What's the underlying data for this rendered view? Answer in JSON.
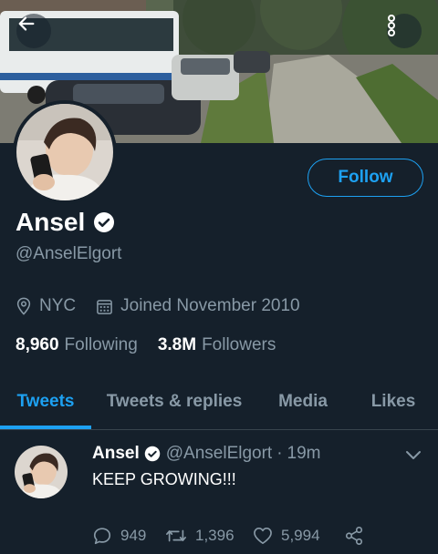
{
  "header": {
    "back_icon": "arrow-left-icon",
    "more_icon": "more-vertical-icon"
  },
  "profile": {
    "name": "Ansel",
    "handle": "@AnselElgort",
    "verified": true,
    "location": "NYC",
    "joined": "Joined November 2010",
    "following_count": "8,960",
    "following_label": "Following",
    "followers_count": "3.8M",
    "followers_label": "Followers",
    "follow_label": "Follow"
  },
  "tabs": [
    {
      "label": "Tweets",
      "active": true
    },
    {
      "label": "Tweets & replies",
      "active": false
    },
    {
      "label": "Media",
      "active": false
    },
    {
      "label": "Likes",
      "active": false
    }
  ],
  "tweet": {
    "name": "Ansel",
    "handle": "@AnselElgort",
    "separator": "·",
    "time": "19m",
    "text": "KEEP GROWING!!!",
    "replies": "949",
    "retweets": "1,396",
    "likes": "5,994"
  },
  "colors": {
    "background": "#15202b",
    "accent": "#1da1f2",
    "secondary_text": "#8899a6",
    "divider": "#38444d"
  }
}
